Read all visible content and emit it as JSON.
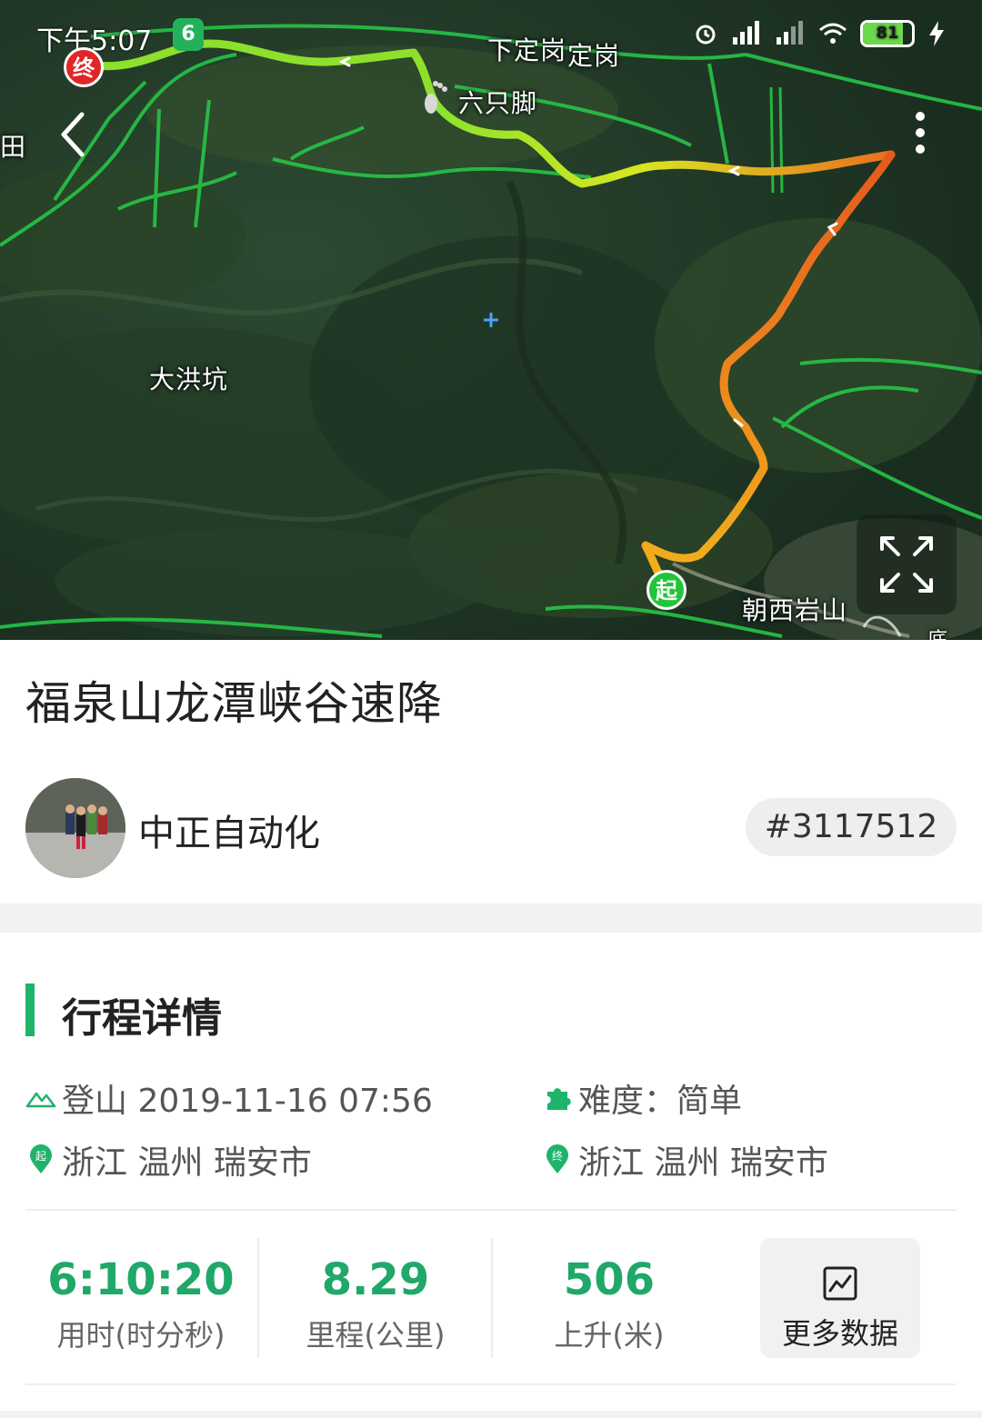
{
  "status_bar": {
    "time": "下午5:07",
    "battery": "81",
    "battery_level": 0.81
  },
  "map": {
    "places": [
      "下定岗",
      "定岗",
      "六只脚",
      "大洪坑",
      "朝西岩山",
      "田",
      "底"
    ],
    "start_marker": "起",
    "end_marker": "终",
    "app_badge": "6"
  },
  "track": {
    "title": "福泉山龙潭峡谷速降",
    "author": "中正自动化",
    "id": "#3117512"
  },
  "section": {
    "title": "行程详情"
  },
  "details": {
    "activity": "登山 2019-11-16 07:56",
    "difficulty": "难度：简单",
    "start_location": "浙江 温州 瑞安市",
    "end_location": "浙江 温州 瑞安市"
  },
  "stats": [
    {
      "value": "6:10:20",
      "label": "用时(时分秒)"
    },
    {
      "value": "8.29",
      "label": "里程(公里)"
    },
    {
      "value": "506",
      "label": "上升(米)"
    }
  ],
  "more_data_label": "更多数据",
  "colors": {
    "accent": "#1fb36b",
    "stat_value": "#1fa868",
    "start_pin": "#22c43a",
    "end_pin": "#e02626"
  }
}
